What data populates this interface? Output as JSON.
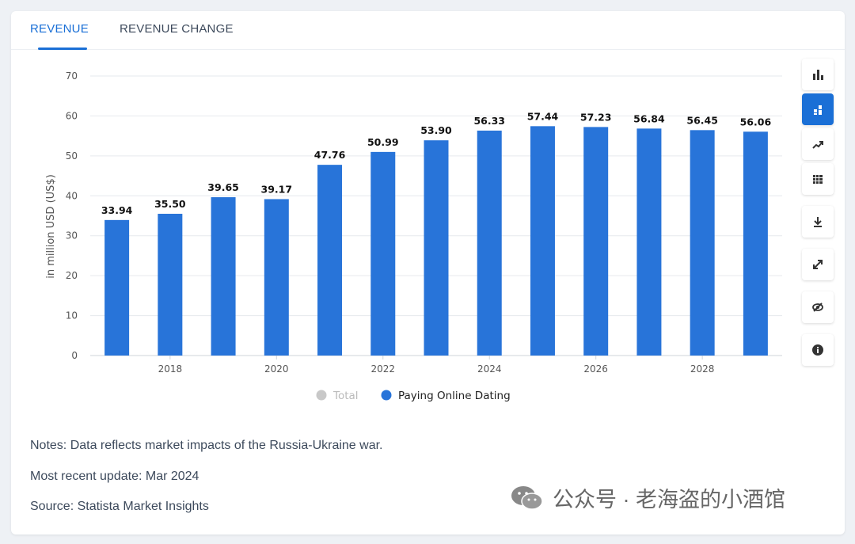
{
  "tabs": [
    {
      "label": "REVENUE",
      "active": true
    },
    {
      "label": "REVENUE CHANGE",
      "active": false
    }
  ],
  "chart_data": {
    "type": "bar",
    "ylabel": "in million USD (US$)",
    "ylim": [
      0,
      70
    ],
    "yticks": [
      0,
      10,
      20,
      30,
      40,
      50,
      60,
      70
    ],
    "years": [
      2017,
      2018,
      2019,
      2020,
      2021,
      2022,
      2023,
      2024,
      2025,
      2026,
      2027,
      2028,
      2029
    ],
    "xtick_labels": [
      "2018",
      "2020",
      "2022",
      "2024",
      "2026",
      "2028"
    ],
    "series": [
      {
        "name": "Paying Online Dating",
        "color": "#2874d9",
        "values": [
          33.94,
          35.5,
          39.65,
          39.17,
          47.76,
          50.99,
          53.9,
          56.33,
          57.44,
          57.23,
          56.84,
          56.45,
          56.06
        ]
      }
    ],
    "value_labels": [
      "33.94",
      "35.50",
      "39.65",
      "39.17",
      "47.76",
      "50.99",
      "53.90",
      "56.33",
      "57.44",
      "57.23",
      "56.84",
      "56.45",
      "56.06"
    ],
    "legend": [
      {
        "label": "Total",
        "color": "#c8c8c8",
        "inactive": true
      },
      {
        "label": "Paying Online Dating",
        "color": "#2874d9",
        "inactive": false
      }
    ],
    "grid": true,
    "legend_position": "bottom-center"
  },
  "sidebar": {
    "buttons": [
      {
        "icon": "bar-chart-icon",
        "active": false
      },
      {
        "icon": "stacked-bar-icon",
        "active": true
      },
      {
        "icon": "line-chart-icon",
        "active": false
      },
      {
        "icon": "table-icon",
        "active": false
      },
      {
        "icon": "download-icon",
        "active": false
      },
      {
        "icon": "expand-icon",
        "active": false
      },
      {
        "icon": "hide-icon",
        "active": false
      },
      {
        "icon": "info-icon",
        "active": false
      }
    ]
  },
  "notes": {
    "note": "Notes: Data reflects market impacts of the Russia-Ukraine war.",
    "update": "Most recent update: Mar 2024",
    "source": "Source: Statista Market Insights"
  },
  "watermark": {
    "text": "公众号 · 老海盗的小酒馆"
  },
  "colors": {
    "accent": "#1a6fd6",
    "bar": "#2874d9",
    "text": "#3d4a5c"
  }
}
